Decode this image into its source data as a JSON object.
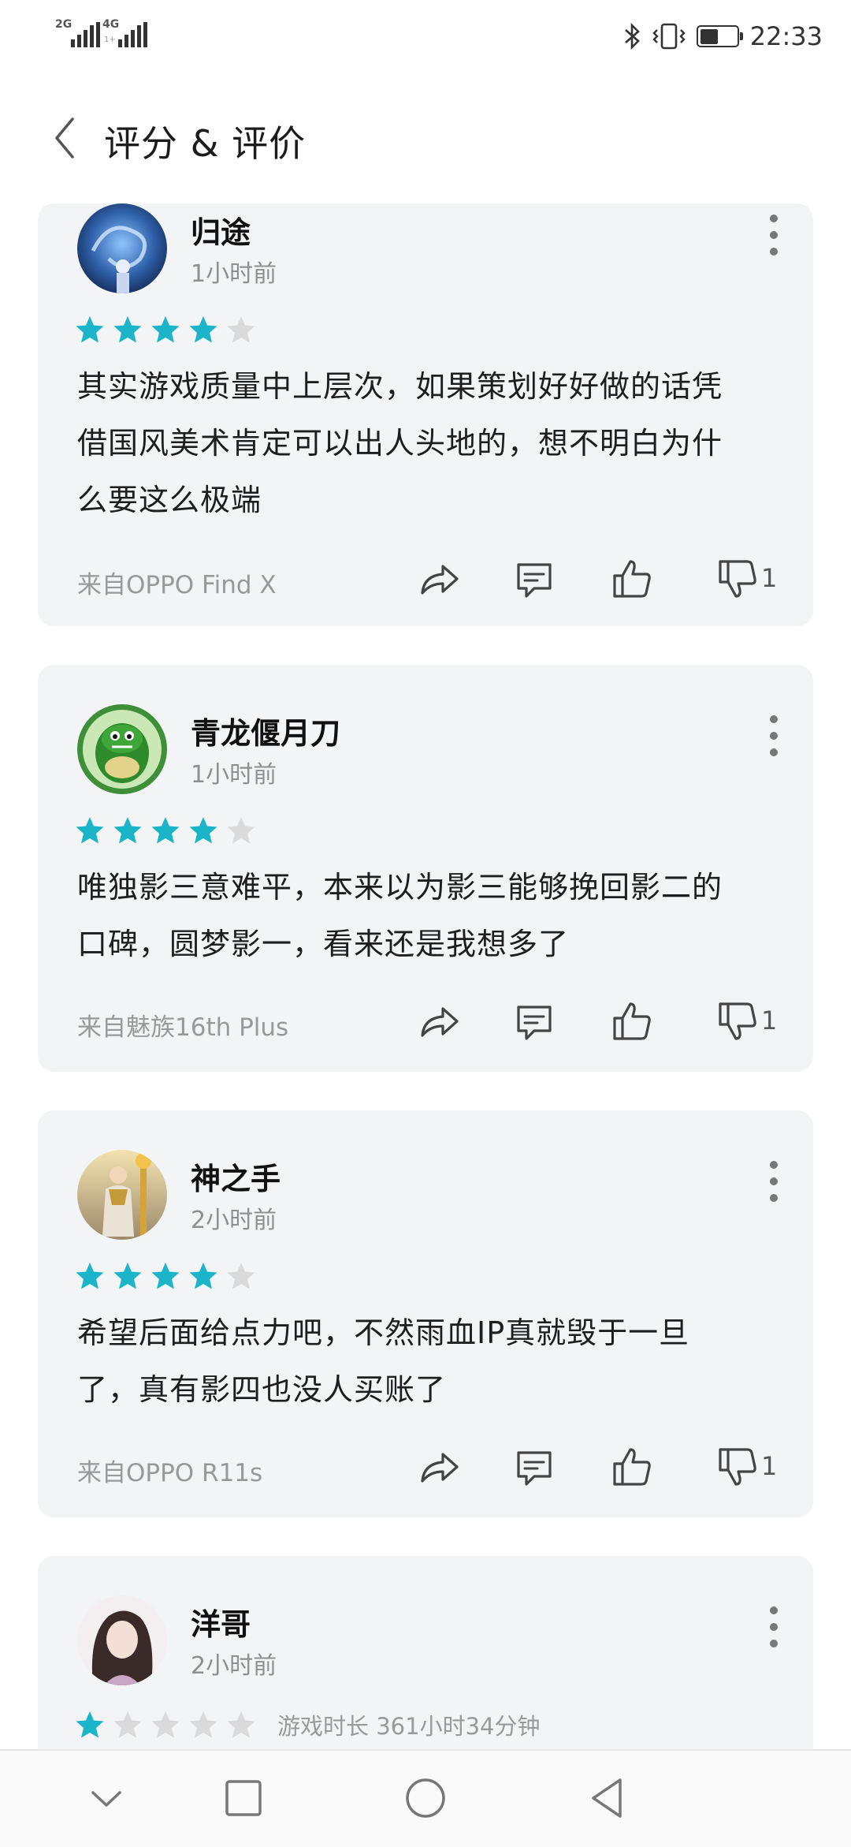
{
  "status_bar": {
    "sim1": "2G",
    "sim2": "4G",
    "sim2_sub": "1+",
    "time": "22:33",
    "battery_level": 0.55
  },
  "header": {
    "title": "评分 & 评价",
    "back_icon": "chevron-left-icon"
  },
  "reviews": [
    {
      "name": "归途",
      "time": "1小时前",
      "rating": 4,
      "max_rating": 5,
      "text_lines": [
        "其实游戏质量中上层次，如果策划好好做的话凭",
        "借国风美术肯定可以出人头地的，想不明白为什",
        "么要这么极端"
      ],
      "device": "来自OPPO Find X",
      "dislike_count": "1"
    },
    {
      "name": "青龙偃月刀",
      "time": "1小时前",
      "rating": 4,
      "max_rating": 5,
      "text_lines": [
        "唯独影三意难平，本来以为影三能够挽回影二的",
        "口碑，圆梦影一，看来还是我想多了"
      ],
      "device": "来自魅族16th Plus",
      "dislike_count": "1"
    },
    {
      "name": "神之手",
      "time": "2小时前",
      "rating": 4,
      "max_rating": 5,
      "text_lines": [
        "希望后面给点力吧，不然雨血IP真就毁于一旦",
        "了，真有影四也没人买账了"
      ],
      "device": "来自OPPO R11s",
      "dislike_count": "1"
    },
    {
      "name": "洋哥",
      "time": "2小时前",
      "rating": 1,
      "max_rating": 5,
      "playtime": "游戏时长 361小时34分钟"
    }
  ],
  "icons": {
    "share": "share-icon",
    "comment": "comment-icon",
    "like": "thumbs-up-icon",
    "dislike": "thumbs-down-icon",
    "more": "more-vertical-icon"
  },
  "colors": {
    "star_on": "#1bb5c9",
    "star_off": "#dadada",
    "card_bg": "#f3f4f6"
  },
  "nav": [
    "chevron-down-icon",
    "square-icon",
    "circle-icon",
    "triangle-back-icon"
  ]
}
